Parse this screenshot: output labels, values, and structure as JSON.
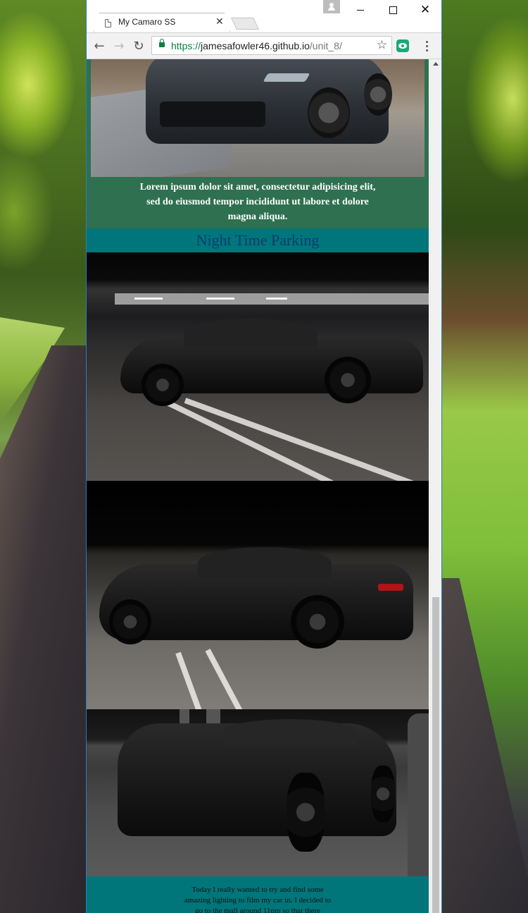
{
  "browser": {
    "tab_title": "My Camaro SS",
    "tab_close_glyph": "✕",
    "url_scheme": "https://",
    "url_host": "jamesafowler46.github.io",
    "url_path": "/unit_8/",
    "icons": {
      "back": "back-arrow-icon",
      "forward": "forward-arrow-icon",
      "reload": "reload-icon",
      "lock": "lock-icon",
      "bookmark": "star-icon",
      "extension": "eye-extension-icon",
      "menu": "kebab-menu-icon"
    }
  },
  "page": {
    "intro_caption": "Lorem ipsum dolor sit amet, consectetur adipisicing elit, sed do eiusmod tempor incididunt ut labore et dolore magna aliqua.",
    "section_heading": "Night Time Parking",
    "story_caption": "Today I really wanted to try and find some amazing lighting to film my car in. I decided to go to the mall around 11pm so that there"
  },
  "colors": {
    "green_block": "#2e7050",
    "teal_band": "#00767a",
    "heading_text": "#0b3b74",
    "window_border": "#2b79c7",
    "secure_green": "#0b8043"
  }
}
